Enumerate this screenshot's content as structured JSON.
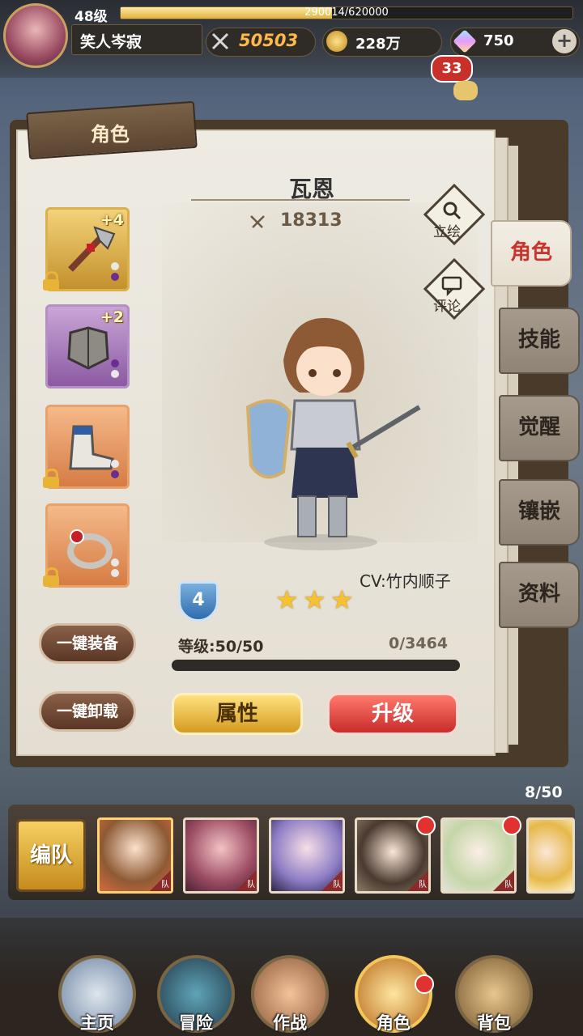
{
  "player": {
    "level": "48级",
    "exp": "290014/620000",
    "exp_fraction": 0.4677,
    "name": "笑人岑寂"
  },
  "resources": {
    "power": "50503",
    "gold": "228万",
    "gems": "750",
    "plus": "+"
  },
  "chat": {
    "count": "33"
  },
  "panel": {
    "title": "角色"
  },
  "hero": {
    "name": "瓦恩",
    "power": "18313",
    "cv": "CV:竹内顺子",
    "rank": "4",
    "stars": 3,
    "level_text": "等级:50/50",
    "exp_text": "0/3464",
    "exp_fraction": 0
  },
  "side_buttons": {
    "portrait": "立绘",
    "comment": "评论"
  },
  "equipment": [
    {
      "name": "weapon",
      "plus": "+4",
      "locked": true
    },
    {
      "name": "armor",
      "plus": "+2",
      "locked": false
    },
    {
      "name": "boots",
      "plus": "",
      "locked": true
    },
    {
      "name": "ring",
      "plus": "",
      "locked": true
    }
  ],
  "buttons": {
    "equip_all": "一键装备",
    "unequip_all": "一键卸载",
    "attributes": "属性",
    "upgrade": "升级"
  },
  "right_tabs": [
    "角色",
    "技能",
    "觉醒",
    "镶嵌",
    "资料"
  ],
  "team": {
    "count": "8/50",
    "button": "编队",
    "tag": "队"
  },
  "nav": [
    "主页",
    "冒险",
    "作战",
    "角色",
    "背包"
  ],
  "colors": {
    "accent_red": "#c7352e",
    "gold": "#e0b13e",
    "power_orange": "#ffb84a"
  }
}
